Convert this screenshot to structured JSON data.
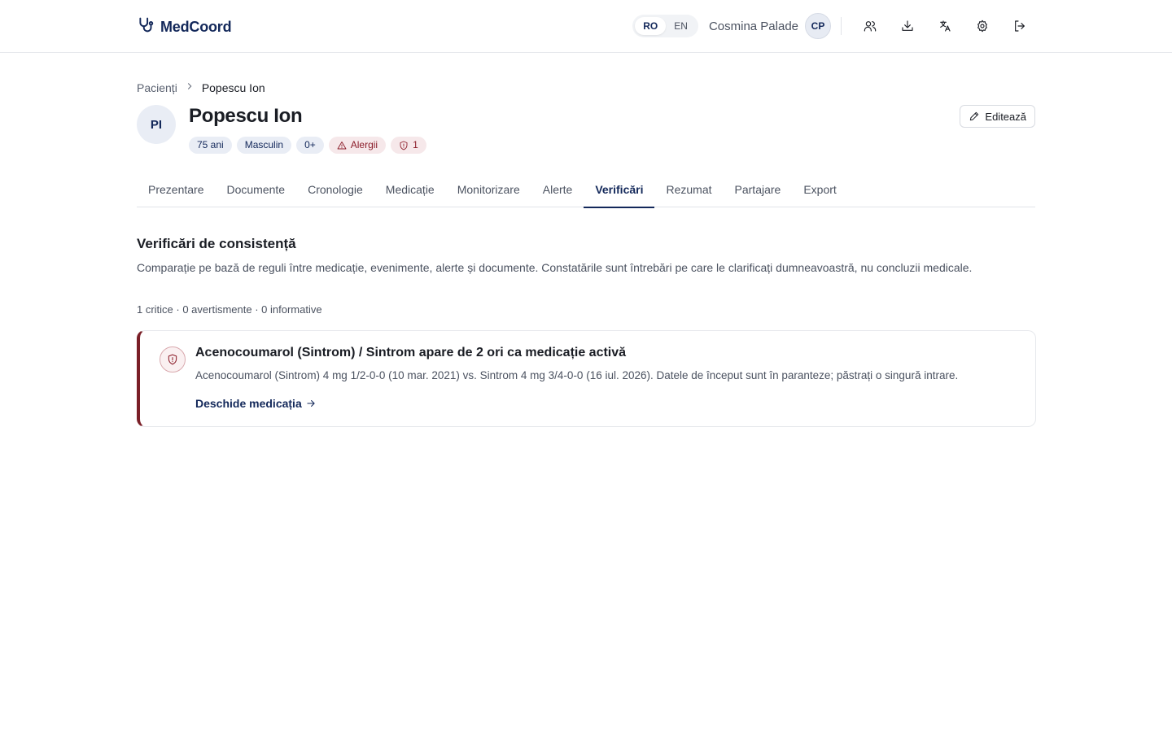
{
  "app": {
    "brand_name": "MedCoord",
    "brand_icon": "stethoscope-icon"
  },
  "header": {
    "languages": [
      "RO",
      "EN"
    ],
    "active_language": "RO",
    "user_name": "Cosmina Palade",
    "user_initials": "CP",
    "icons": [
      "users-icon",
      "download-icon",
      "translate-icon",
      "gear-icon",
      "logout-icon"
    ]
  },
  "breadcrumb": {
    "parent": "Pacienți",
    "current": "Popescu Ion"
  },
  "patient": {
    "initials": "PI",
    "name": "Popescu Ion",
    "age": "75 ani",
    "sex": "Masculin",
    "blood_type": "0+",
    "allergies_label": "Alergii",
    "alerts_count": "1",
    "edit_label": "Editează"
  },
  "tabs": [
    "Prezentare",
    "Documente",
    "Cronologie",
    "Medicație",
    "Monitorizare",
    "Alerte",
    "Verificări",
    "Rezumat",
    "Partajare",
    "Export"
  ],
  "active_tab": "Verificări",
  "checks": {
    "title": "Verificări de consistență",
    "description": "Comparație pe bază de reguli între medicație, evenimente, alerte și documente. Constatările sunt întrebări pe care le clarificați dumneavoastră, nu concluzii medicale.",
    "summary": "1 critice · 0 avertismente · 0 informative",
    "findings": [
      {
        "severity": "critical",
        "title": "Acenocoumarol (Sintrom) / Sintrom apare de 2 ori ca medicație activă",
        "detail": "Acenocoumarol (Sintrom) 4 mg 1/2-0-0 (10 mar. 2021) vs. Sintrom 4 mg 3/4-0-0 (16 iul. 2026). Datele de început sunt în paranteze; păstrați o singură intrare.",
        "link_label": "Deschide medicația"
      }
    ]
  },
  "colors": {
    "brand": "#13285a",
    "critical": "#7a1f27",
    "chip_bg": "#e9edf5",
    "chip_danger_bg": "#f6e8ea"
  }
}
